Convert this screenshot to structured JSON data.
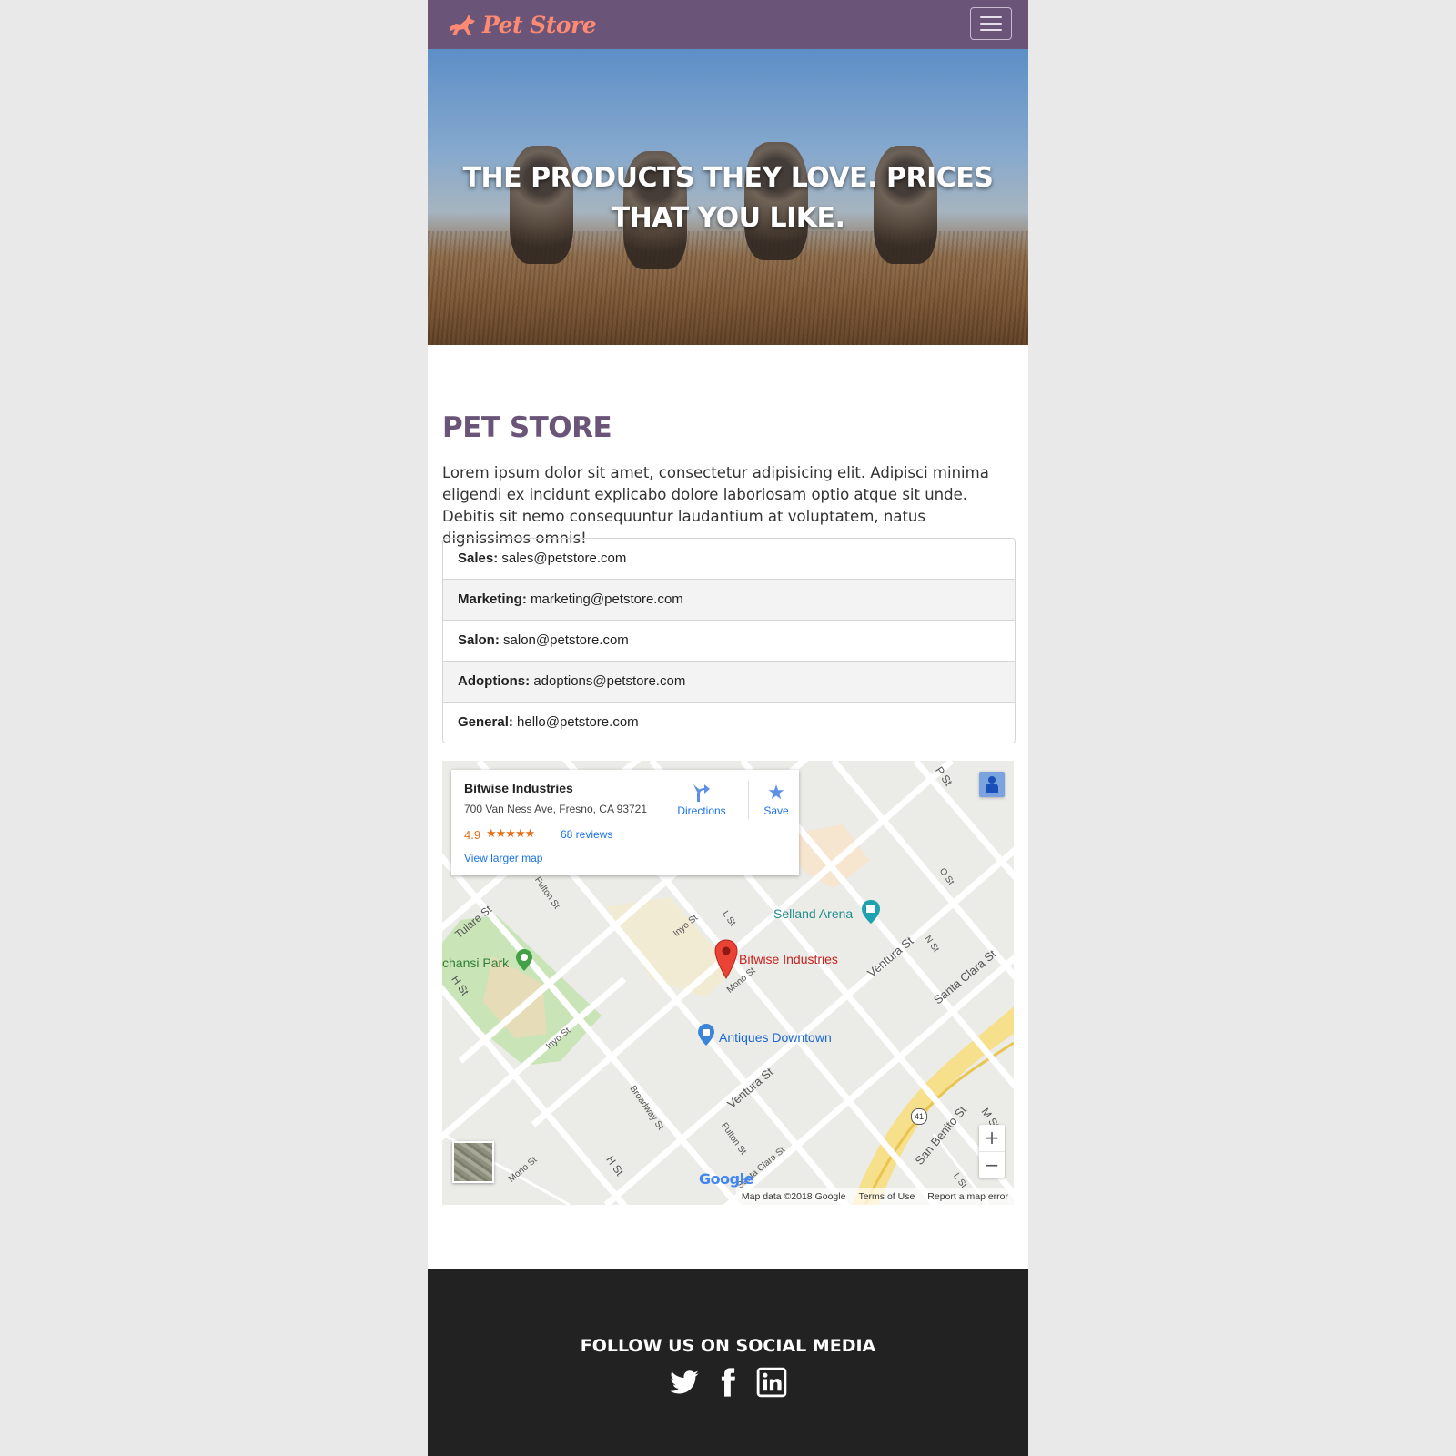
{
  "navbar": {
    "brand": "Pet Store",
    "menu_icon": "hamburger-menu-icon",
    "background": "#6a5478",
    "brand_color": "#ff8a73"
  },
  "hero": {
    "title": "THE PRODUCTS THEY LOVE. PRICES THAT YOU LIKE."
  },
  "main": {
    "title": "PET STORE",
    "intro": "Lorem ipsum dolor sit amet, consectetur adipisicing elit. Adipisci minima eligendi ex incidunt explicabo dolore laboriosam optio atque sit unde. Debitis sit nemo consequuntur laudantium at voluptatem, natus dignissimos omnis!",
    "contacts": [
      {
        "label": "Sales:",
        "email": "sales@petstore.com"
      },
      {
        "label": "Marketing:",
        "email": "marketing@petstore.com"
      },
      {
        "label": "Salon:",
        "email": "salon@petstore.com"
      },
      {
        "label": "Adoptions:",
        "email": "adoptions@petstore.com"
      },
      {
        "label": "General:",
        "email": "hello@petstore.com"
      }
    ]
  },
  "map": {
    "card": {
      "name": "Bitwise Industries",
      "address": "700 Van Ness Ave, Fresno, CA 93721",
      "rating": "4.9",
      "stars": "★★★★★",
      "reviews": "68 reviews",
      "larger_map": "View larger map",
      "directions": "Directions",
      "save": "Save"
    },
    "places": {
      "selland": "Selland Arena",
      "bitwise": "Bitwise Industries",
      "antiques": "Antiques Downtown",
      "park": "chansi Park"
    },
    "streets": {
      "tulare": "Tulare St",
      "h_st": "H St",
      "fulton": "Fulton St",
      "inyo": "Inyo St",
      "l_st": "L St",
      "mono": "Mono St",
      "ventura": "Ventura St",
      "n_st": "N St",
      "santa_clara": "Santa Clara St",
      "o_st": "O St",
      "p_st": "P St",
      "broadway": "Broadway St",
      "san_benito": "San Benito St",
      "route": "41",
      "m_st": "M St",
      "h_st2": "H St",
      "inyo2": "Inyo St",
      "ventura2": "Ventura St",
      "fulton2": "Fulton St",
      "santa_clara2": "Santa Clara St",
      "mono2": "Mono St",
      "l_st2": "L St"
    },
    "zoom_in": "+",
    "zoom_out": "−",
    "google": "Google",
    "attribution": {
      "data": "Map data ©2018 Google",
      "terms": "Terms of Use",
      "report": "Report a map error"
    }
  },
  "footer": {
    "follow": "FOLLOW US ON SOCIAL MEDIA",
    "socials": [
      "twitter-icon",
      "facebook-icon",
      "linkedin-icon"
    ]
  }
}
